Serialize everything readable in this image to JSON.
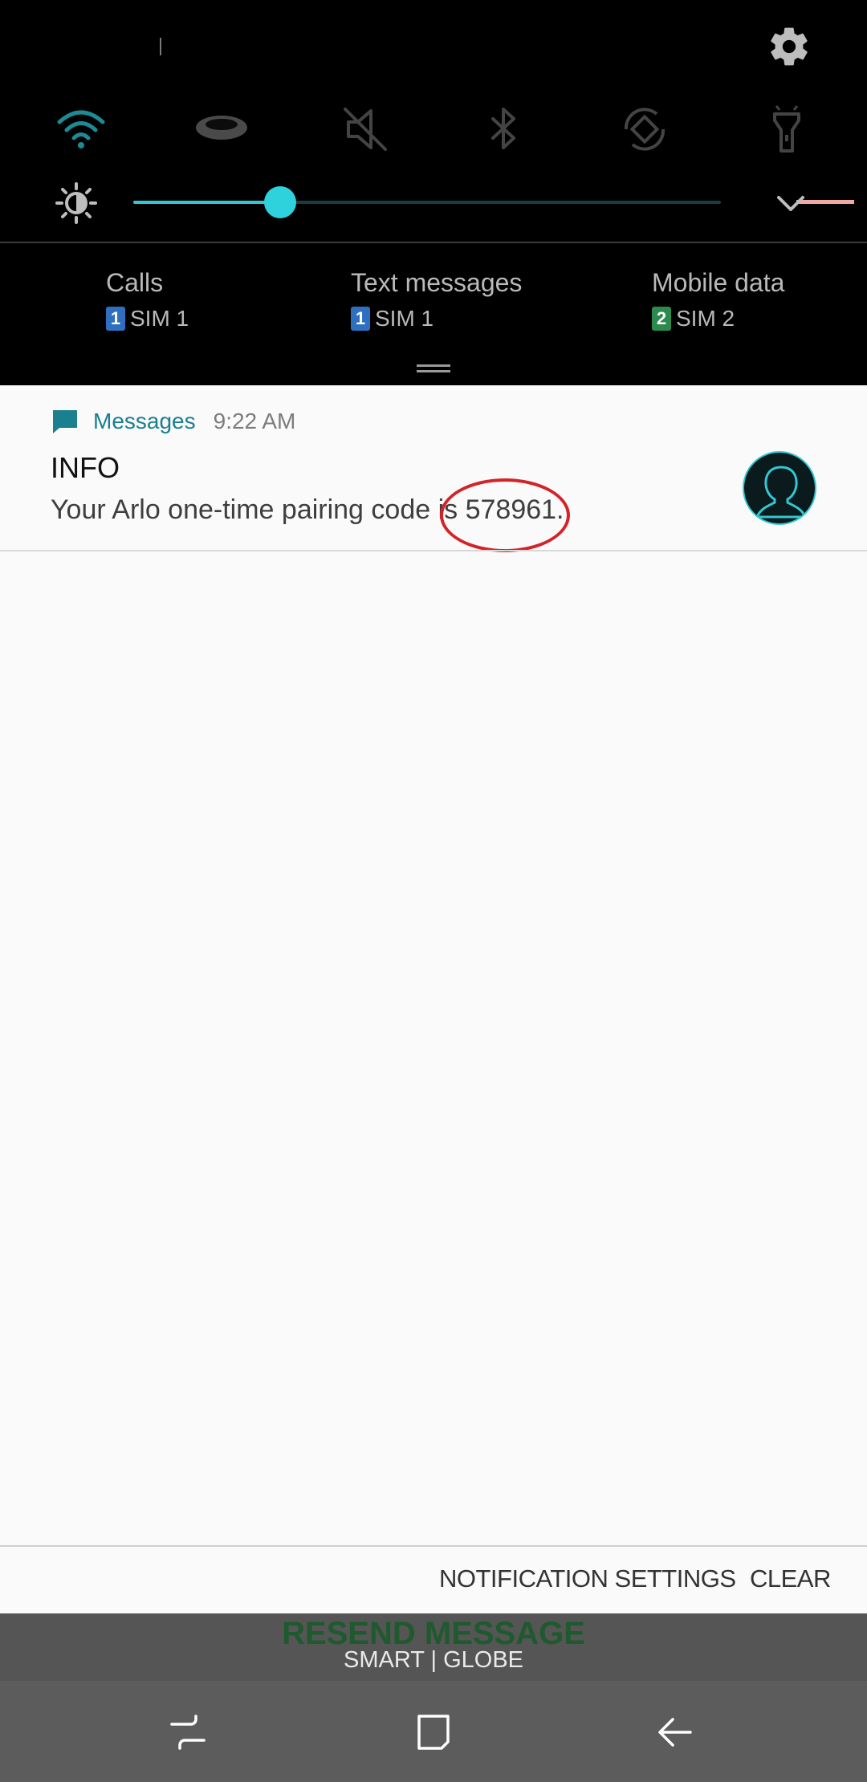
{
  "quick_panel": {
    "icons": [
      "wifi-icon",
      "hotspot-icon",
      "mute-icon",
      "bluetooth-icon",
      "auto-rotate-icon",
      "flashlight-icon"
    ],
    "brightness_percent": 25,
    "accent_color": "#2ed2dc"
  },
  "sim_settings": [
    {
      "title": "Calls",
      "badge": "1",
      "sim": "SIM 1"
    },
    {
      "title": "Text messages",
      "badge": "1",
      "sim": "SIM 1"
    },
    {
      "title": "Mobile data",
      "badge": "2",
      "sim": "SIM 2"
    }
  ],
  "notification": {
    "app": "Messages",
    "time": "9:22 AM",
    "sender": "INFO",
    "body": "Your Arlo one-time pairing code is 578961."
  },
  "actions": {
    "settings_label": "NOTIFICATION SETTINGS",
    "clear_label": "CLEAR"
  },
  "behind": {
    "title": "RESEND MESSAGE",
    "subtitle": "SMART | GLOBE"
  },
  "nav": [
    "recents-icon",
    "home-icon",
    "back-icon"
  ]
}
